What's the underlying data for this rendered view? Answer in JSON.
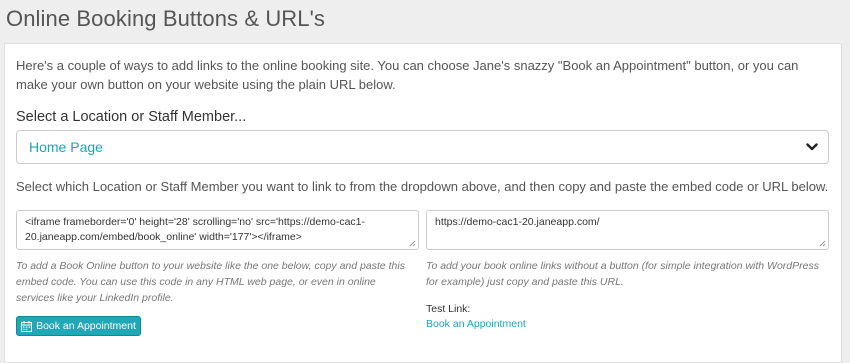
{
  "page": {
    "title": "Online Booking Buttons & URL's"
  },
  "card": {
    "intro": "Here's a couple of ways to add links to the online booking site. You can choose Jane's snazzy \"Book an Appointment\" button, or you can make your own button on your website using the plain URL below.",
    "select_label": "Select a Location or Staff Member...",
    "dropdown": {
      "selected": "Home Page",
      "icon": "chevron-down-icon"
    },
    "instructions": "Select which Location or Staff Member you want to link to from the dropdown above, and then copy and paste the embed code or URL below.",
    "embed": {
      "code": "<iframe frameborder='0' height='28' scrolling='no' src='https://demo-cac1-20.janeapp.com/embed/book_online' width='177'></iframe>",
      "help": "To add a Book Online button to your website like the one below, copy and paste this embed code. You can use this code in any HTML web page, or even in online services like your LinkedIn profile.",
      "button_label": "Book an Appointment",
      "button_icon": "calendar-icon"
    },
    "url": {
      "value": "https://demo-cac1-20.janeapp.com/",
      "help": "To add your book online links without a button (for simple integration with WordPress for example) just copy and paste this URL.",
      "test_label": "Test Link:",
      "test_link": "Book an Appointment"
    }
  },
  "colors": {
    "accent": "#20a8b8",
    "link": "#1aa5b8",
    "background": "#eeeeee"
  }
}
